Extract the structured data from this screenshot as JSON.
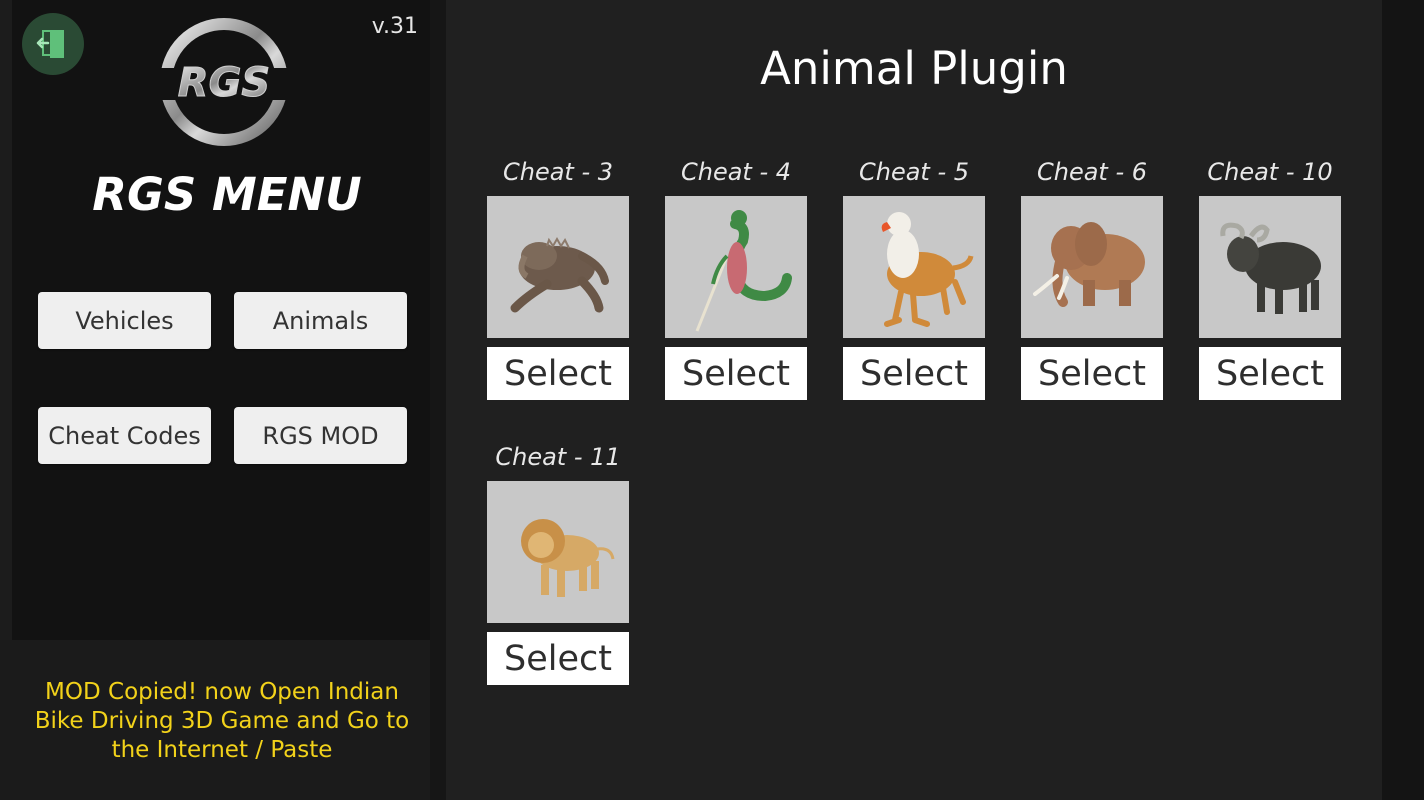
{
  "header": {
    "version": "v.31",
    "exit_icon": "exit-door-icon",
    "logo_text": "RGS",
    "menu_title": "RGS MENU"
  },
  "sidebar": {
    "buttons": [
      {
        "label": "Vehicles"
      },
      {
        "label": "Animals"
      },
      {
        "label": "Cheat Codes"
      },
      {
        "label": "RGS MOD"
      }
    ],
    "message": "MOD Copied! now Open Indian Bike Driving 3D Game and Go to the Internet / Paste",
    "message_color": "#f2d21a"
  },
  "main": {
    "title": "Animal Plugin",
    "cards": [
      {
        "label": "Cheat - 3",
        "animal": "gorilla-beast",
        "button": "Select"
      },
      {
        "label": "Cheat - 4",
        "animal": "naga-serpent",
        "button": "Select"
      },
      {
        "label": "Cheat - 5",
        "animal": "griffin-eagle",
        "button": "Select"
      },
      {
        "label": "Cheat - 6",
        "animal": "elephant",
        "button": "Select"
      },
      {
        "label": "Cheat - 10",
        "animal": "buffalo",
        "button": "Select"
      },
      {
        "label": "Cheat - 11",
        "animal": "lion",
        "button": "Select"
      }
    ]
  },
  "colors": {
    "accent_exit": "#2a4a34",
    "card_bg": "#c8c8c8",
    "panel_bg": "#121212",
    "main_bg": "#202020"
  }
}
